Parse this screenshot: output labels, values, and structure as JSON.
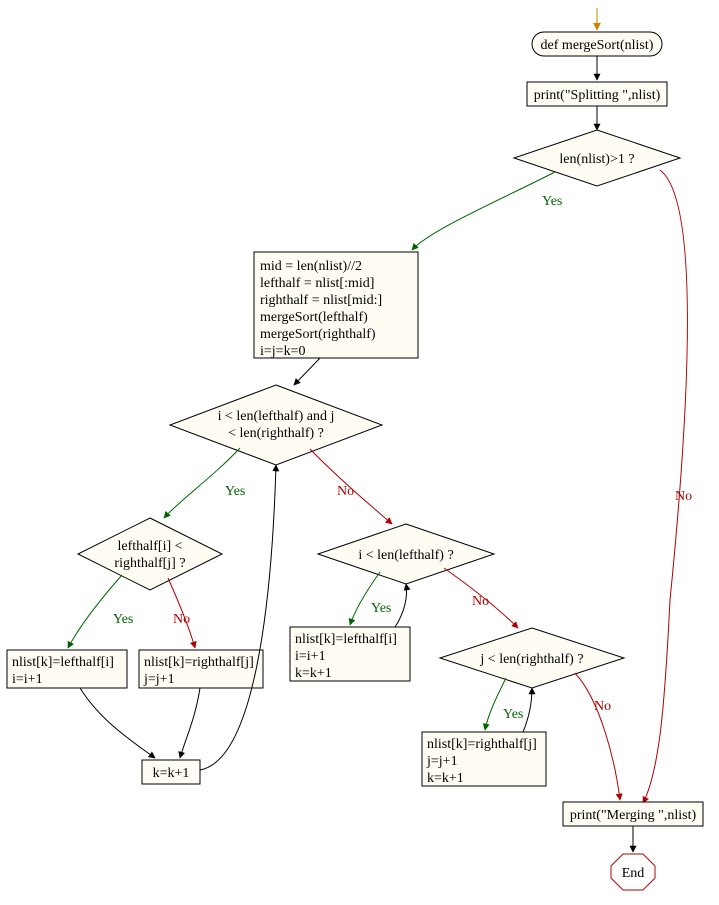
{
  "nodes": {
    "start_func": "def mergeSort(nlist)",
    "print_split": "print(\"Splitting \",nlist)",
    "cond_len": "len(nlist)>1 ?",
    "block_mid": {
      "l1": "mid = len(nlist)//2",
      "l2": "lefthalf = nlist[:mid]",
      "l3": "righthalf = nlist[mid:]",
      "l4": "mergeSort(lefthalf)",
      "l5": "mergeSort(righthalf)",
      "l6": "i=j=k=0"
    },
    "cond_ij": {
      "l1": "i < len(lefthalf) and j",
      "l2": "< len(righthalf) ?"
    },
    "cond_lt": {
      "l1": "lefthalf[i] <",
      "l2": "righthalf[j] ?"
    },
    "asgn_left": {
      "l1": "nlist[k]=lefthalf[i]",
      "l2": "i=i+1"
    },
    "asgn_right": {
      "l1": "nlist[k]=righthalf[j]",
      "l2": "j=j+1"
    },
    "k_inc": "k=k+1",
    "cond_i": "i < len(lefthalf) ?",
    "blk_i": {
      "l1": "nlist[k]=lefthalf[i]",
      "l2": "i=i+1",
      "l3": "k=k+1"
    },
    "cond_j": "j < len(righthalf) ?",
    "blk_j": {
      "l1": "nlist[k]=righthalf[j]",
      "l2": "j=j+1",
      "l3": "k=k+1"
    },
    "print_merge": "print(\"Merging \",nlist)",
    "end": "End"
  },
  "labels": {
    "yes": "Yes",
    "no": "No"
  }
}
